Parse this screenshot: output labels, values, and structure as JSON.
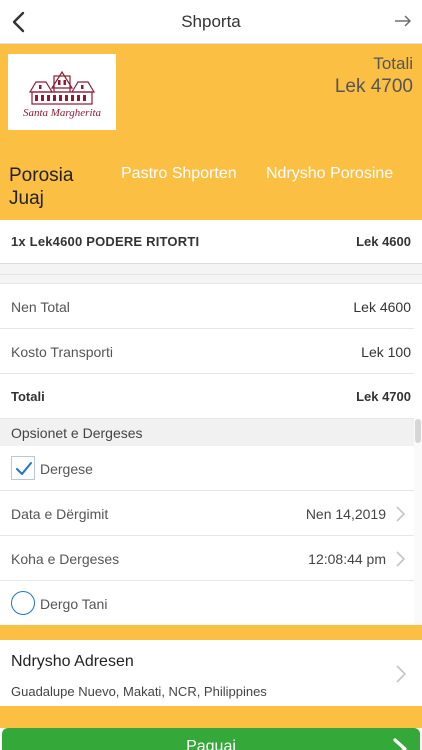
{
  "nav": {
    "title": "Shporta",
    "back_icon": "chevron-left-icon",
    "forward_icon": "arrow-right-icon"
  },
  "hero": {
    "logo_text": "Santa Margherita",
    "total_label": "Totali",
    "total_value": "Lek 4700",
    "order_label": "Porosia Juaj",
    "clear_label": "Pastro Shporten",
    "change_label": "Ndrysho Porosine"
  },
  "cart": {
    "items": [
      {
        "name": "1x Lek4600 PODERE RITORTI",
        "price": "Lek 4600"
      }
    ]
  },
  "summary": {
    "subtotal_label": "Nen Total",
    "subtotal_value": "Lek 4600",
    "shipping_label": "Kosto Transporti",
    "shipping_value": "Lek 100",
    "total_label": "Totali",
    "total_value": "Lek 4700"
  },
  "delivery": {
    "section_title": "Opsionet e Dergeses",
    "delivery_option": {
      "label": "Dergese",
      "checked": true
    },
    "date_label": "Data e Dërgimit",
    "date_value": "Nen 14,2019",
    "time_label": "Koha e Dergeses",
    "time_value": "12:08:44 pm",
    "now_option": {
      "label": "Dergo Tani",
      "checked": false
    }
  },
  "address": {
    "title": "Ndrysho Adresen",
    "value": "Guadalupe Nuevo, Makati, NCR, Philippines"
  },
  "pay": {
    "label": "Paguaj"
  },
  "colors": {
    "accent_yellow": "#fbbf44",
    "pay_green": "#34a839",
    "check_blue": "#1f74c5",
    "logo_red": "#8e1b32"
  }
}
